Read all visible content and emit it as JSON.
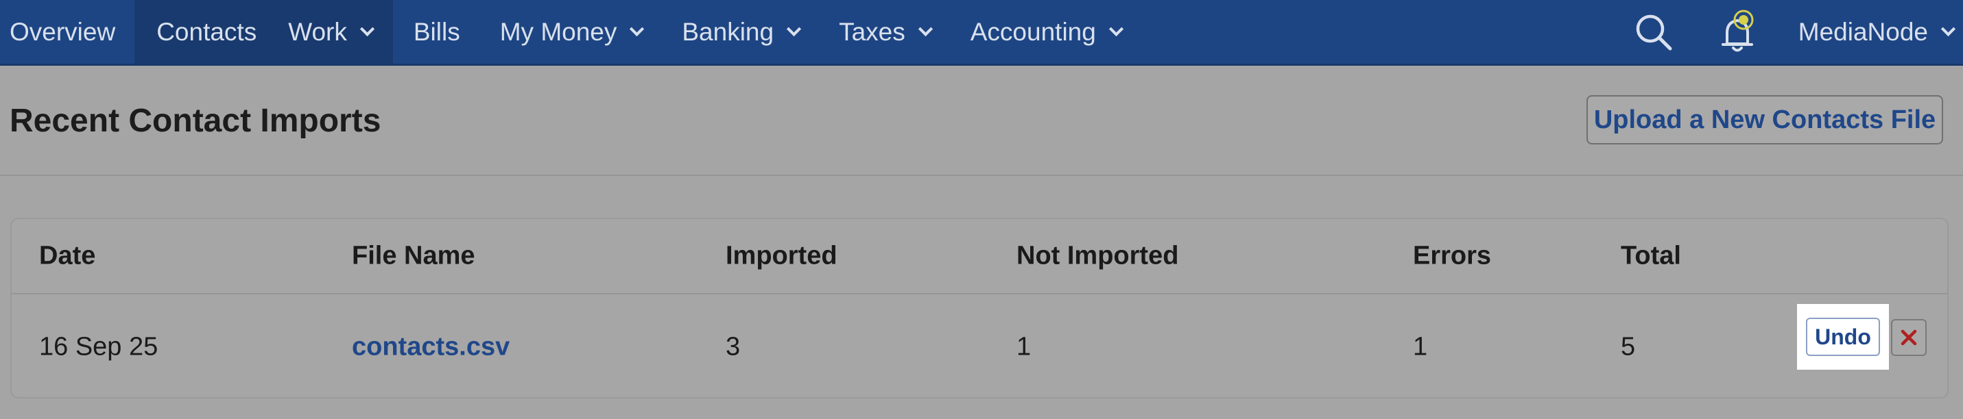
{
  "nav": {
    "items": [
      {
        "label": "Overview"
      },
      {
        "label": "Contacts"
      },
      {
        "label": "Work"
      },
      {
        "label": "Bills"
      },
      {
        "label": "My Money"
      },
      {
        "label": "Banking"
      },
      {
        "label": "Taxes"
      },
      {
        "label": "Accounting"
      }
    ],
    "user": "MediaNode",
    "colors": {
      "bar": "#1e4583",
      "active": "#193a6e",
      "bell_dot": "#d6d04a"
    }
  },
  "page": {
    "title": "Recent Contact Imports",
    "upload_label": "Upload a New Contacts File"
  },
  "table": {
    "headers": [
      "Date",
      "File Name",
      "Imported",
      "Not Imported",
      "Errors",
      "Total"
    ],
    "rows": [
      {
        "date": "16 Sep 25",
        "file": "contacts.csv",
        "imported": "3",
        "not_imported": "1",
        "errors": "1",
        "total": "5"
      }
    ],
    "undo_label": "Undo"
  }
}
